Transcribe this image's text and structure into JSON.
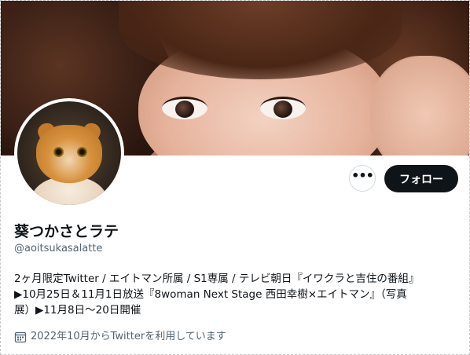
{
  "profile": {
    "display_name": "葵つかさとラテ",
    "handle": "@aoitsukasalatte",
    "bio_lines": [
      "2ヶ月限定Twitter / エイトマン所属 / S1専属 / テレビ朝日『イワクラと吉住の番組』",
      "▶︎10月25日＆11月1日放送『8woman Next Stage 西田幸樹×エイトマン』（写真",
      "展）▶︎11月8日〜20日開催"
    ],
    "joined": "2022年10月からTwitterを利用しています"
  },
  "actions": {
    "more_icon": "more-horizontal-icon",
    "more_label": "•••",
    "follow_label": "フォロー"
  },
  "colors": {
    "follow_bg": "#0f1419",
    "text_primary": "#0f1419",
    "text_secondary": "#536471",
    "border": "#cfd9de"
  },
  "icons": {
    "calendar": "calendar-icon"
  }
}
